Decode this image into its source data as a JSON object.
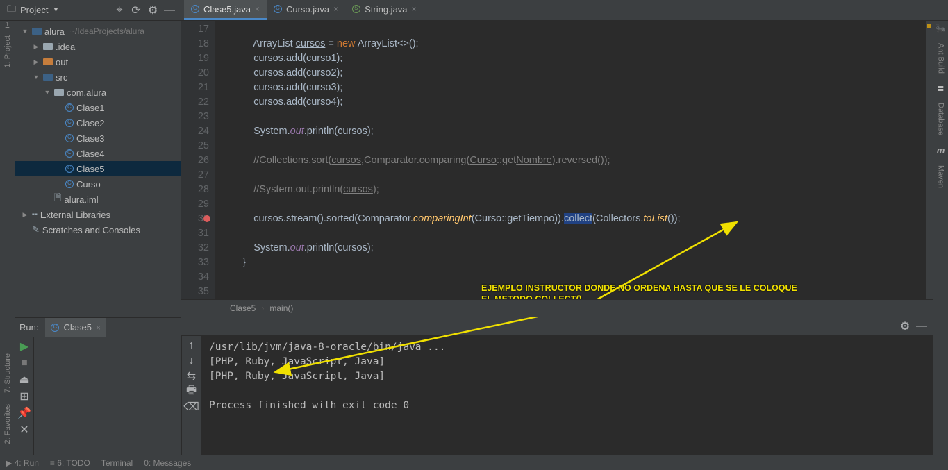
{
  "topbar": {
    "project_label": "Project",
    "icons": {
      "target": "⌖",
      "refresh": "⟳",
      "settings": "⚙",
      "hide": "—"
    }
  },
  "tabs": [
    {
      "label": "Clase5.java",
      "selected": true,
      "kind": "c"
    },
    {
      "label": "Curso.java",
      "selected": false,
      "kind": "c"
    },
    {
      "label": "String.java",
      "selected": false,
      "kind": "c-green"
    }
  ],
  "left_gutter": {
    "project": "1: Project",
    "structure": "7: Structure",
    "favorites": "2: Favorites"
  },
  "right_gutter": {
    "ant": "Ant Build",
    "database": "Database",
    "maven": "Maven",
    "m": "m"
  },
  "tree": [
    {
      "indent": 0,
      "arrow": "▼",
      "icon": "folder-blue",
      "label": "alura",
      "sub": "~/IdeaProjects/alura"
    },
    {
      "indent": 1,
      "arrow": "▶",
      "icon": "folder",
      "label": ".idea"
    },
    {
      "indent": 1,
      "arrow": "▶",
      "icon": "folder-orange",
      "label": "out"
    },
    {
      "indent": 1,
      "arrow": "▼",
      "icon": "folder-blue",
      "label": "src"
    },
    {
      "indent": 2,
      "arrow": "▼",
      "icon": "folder",
      "label": "com.alura"
    },
    {
      "indent": 3,
      "arrow": "",
      "icon": "class",
      "label": "Clase1"
    },
    {
      "indent": 3,
      "arrow": "",
      "icon": "class",
      "label": "Clase2"
    },
    {
      "indent": 3,
      "arrow": "",
      "icon": "class",
      "label": "Clase3"
    },
    {
      "indent": 3,
      "arrow": "",
      "icon": "class",
      "label": "Clase4"
    },
    {
      "indent": 3,
      "arrow": "",
      "icon": "class",
      "label": "Clase5",
      "selected": true
    },
    {
      "indent": 3,
      "arrow": "",
      "icon": "class",
      "label": "Curso"
    },
    {
      "indent": 2,
      "arrow": "",
      "icon": "file",
      "label": "alura.iml"
    },
    {
      "indent": 0,
      "arrow": "▶",
      "icon": "lib",
      "label": "External Libraries"
    },
    {
      "indent": 0,
      "arrow": "",
      "icon": "scratch",
      "label": "Scratches and Consoles"
    }
  ],
  "editor": {
    "first_line": 17,
    "lines": [
      {
        "n": 17,
        "raw": ""
      },
      {
        "n": 18,
        "raw": "        ArrayList<Curso> <u>cursos</u> = <kw>new</kw> ArrayList<>();"
      },
      {
        "n": 19,
        "raw": "        cursos.add(curso1);"
      },
      {
        "n": 20,
        "raw": "        cursos.add(curso2);"
      },
      {
        "n": 21,
        "raw": "        cursos.add(curso3);"
      },
      {
        "n": 22,
        "raw": "        cursos.add(curso4);"
      },
      {
        "n": 23,
        "raw": ""
      },
      {
        "n": 24,
        "raw": "        System.<fld>out</fld>.println(cursos);"
      },
      {
        "n": 25,
        "raw": ""
      },
      {
        "n": 26,
        "raw": "        <com>//Collections.sort(<u>cursos</u>,Comparator.comparing(<u>Curso</u>::get<u>Nombre</u>).reversed());</com>"
      },
      {
        "n": 27,
        "raw": ""
      },
      {
        "n": 28,
        "raw": "        <com>//System.out.println(<u>cursos</u>);</com>"
      },
      {
        "n": 29,
        "raw": ""
      },
      {
        "n": 30,
        "raw": "        cursos.stream().sorted(Comparator.<mth>comparingInt</mth>(Curso::getTiempo)).<hl>collect</hl>(Collectors.<mth>toList</mth>());",
        "bp": true
      },
      {
        "n": 31,
        "raw": ""
      },
      {
        "n": 32,
        "raw": "        System.<fld>out</fld>.println(cursos);"
      },
      {
        "n": 33,
        "raw": "    }"
      },
      {
        "n": 34,
        "raw": ""
      },
      {
        "n": 35,
        "raw": ""
      }
    ]
  },
  "breadcrumbs": {
    "cls": "Clase5",
    "mth": "main()"
  },
  "run": {
    "label": "Run:",
    "tab": "Clase5",
    "output": "/usr/lib/jvm/java-8-oracle/bin/java ...\n[PHP, Ruby, JavaScript, Java]\n[PHP, Ruby, JavaScript, Java]\n\nProcess finished with exit code 0"
  },
  "annotation": {
    "line1": "EJEMPLO INSTRUCTOR DONDE NO ORDENA HASTA QUE SE LE COLOQUE",
    "line2": "EL METODO COLLECT()"
  },
  "bottom": {
    "run": "▶ 4: Run",
    "todo": "≡ 6: TODO",
    "terminal": "Terminal",
    "messages": "0: Messages"
  }
}
